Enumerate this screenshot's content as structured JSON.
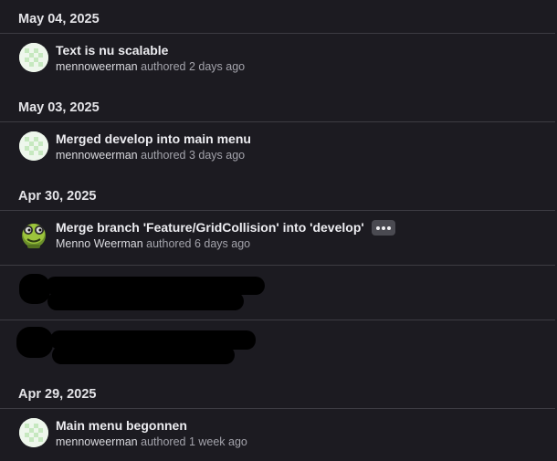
{
  "groups": [
    {
      "date": "May 04, 2025",
      "commits": [
        {
          "message": "Text is nu scalable",
          "author": "mennoweerman",
          "time": "authored 2 days ago",
          "avatar": "identicon-green"
        }
      ]
    },
    {
      "date": "May 03, 2025",
      "commits": [
        {
          "message": "Merged develop into main menu",
          "author": "mennoweerman",
          "time": "authored 3 days ago",
          "avatar": "identicon-green"
        }
      ]
    },
    {
      "date": "Apr 30, 2025",
      "commits": [
        {
          "message": "Merge branch 'Feature/GridCollision' into 'develop'",
          "author": "Menno Weerman",
          "time": "authored 6 days ago",
          "avatar": "alien-avatar"
        }
      ]
    },
    {
      "date": "Apr 29, 2025",
      "commits": [
        {
          "message": "Main menu begonnen",
          "author": "mennoweerman",
          "time": "authored 1 week ago",
          "avatar": "identicon-green"
        }
      ]
    }
  ],
  "icons": {
    "identicon": "identicon-avatar",
    "alien": "alien-avatar",
    "more": "ellipsis-icon"
  },
  "colors": {
    "background": "#1c1b21",
    "divider": "#3d3c43",
    "identicon": "#c6e8bf"
  }
}
